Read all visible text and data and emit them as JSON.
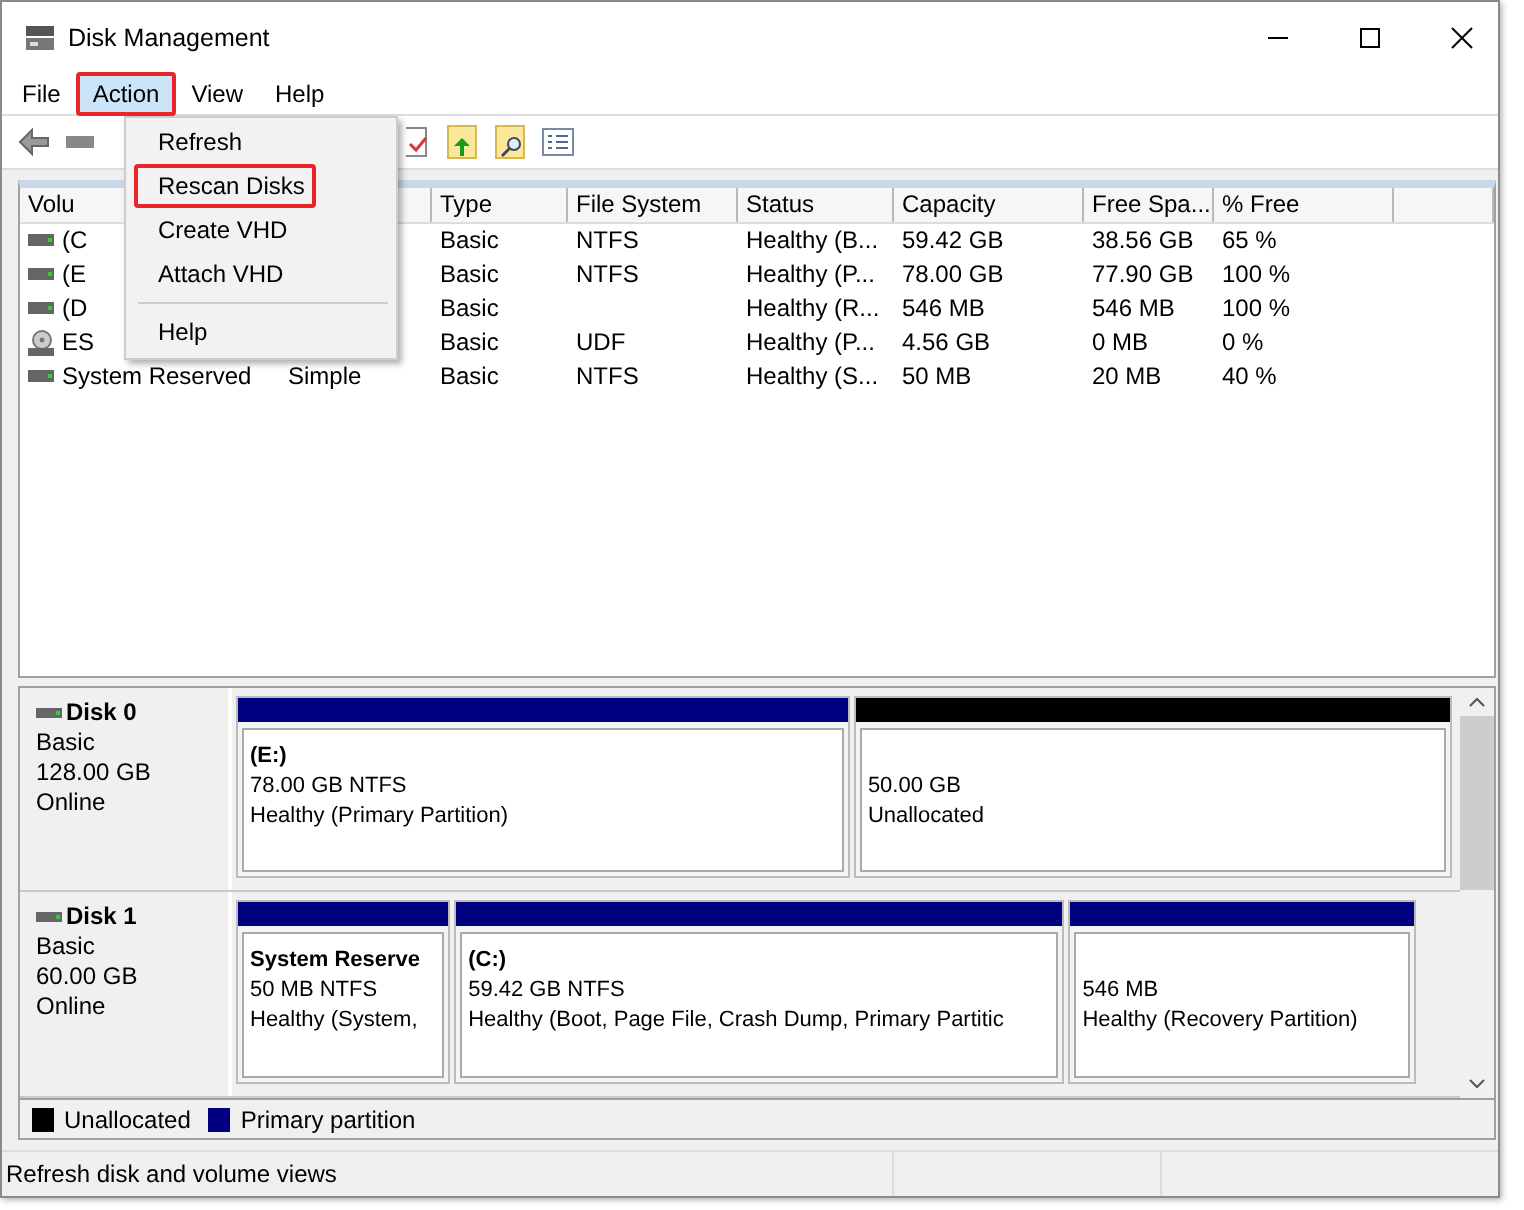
{
  "window": {
    "title": "Disk Management"
  },
  "menu_bar": [
    {
      "label": "File",
      "selected": false,
      "highlighted": false
    },
    {
      "label": "Action",
      "selected": true,
      "highlighted": true
    },
    {
      "label": "View",
      "selected": false,
      "highlighted": false
    },
    {
      "label": "Help",
      "selected": false,
      "highlighted": false
    }
  ],
  "action_menu": {
    "items": [
      {
        "kind": "item",
        "label": "Refresh",
        "highlighted": false
      },
      {
        "kind": "item",
        "label": "Rescan Disks",
        "highlighted": true
      },
      {
        "kind": "item",
        "label": "Create VHD",
        "highlighted": false
      },
      {
        "kind": "item",
        "label": "Attach VHD",
        "highlighted": false
      },
      {
        "kind": "separator"
      },
      {
        "kind": "item",
        "label": "Help",
        "highlighted": false
      }
    ]
  },
  "volume_table": {
    "columns": [
      "Volu",
      "",
      "Type",
      "File System",
      "Status",
      "Capacity",
      "Free Spa...",
      "% Free"
    ],
    "rows": [
      {
        "kind": "drive",
        "cells": [
          "(C",
          "",
          "Basic",
          "NTFS",
          "Healthy (B...",
          "59.42 GB",
          "38.56 GB",
          "65 %"
        ]
      },
      {
        "kind": "drive",
        "cells": [
          "(E",
          "",
          "Basic",
          "NTFS",
          "Healthy (P...",
          "78.00 GB",
          "77.90 GB",
          "100 %"
        ]
      },
      {
        "kind": "drive",
        "cells": [
          "(D",
          "",
          "Basic",
          "",
          "Healthy (R...",
          "546 MB",
          "546 MB",
          "100 %"
        ]
      },
      {
        "kind": "disc",
        "cells": [
          "ES",
          "",
          "Basic",
          "UDF",
          "Healthy (P...",
          "4.56 GB",
          "0 MB",
          "0 %"
        ]
      },
      {
        "kind": "drive",
        "cells": [
          "System Reserved",
          "Simple",
          "Basic",
          "NTFS",
          "Healthy (S...",
          "50 MB",
          "20 MB",
          "40 %"
        ]
      }
    ]
  },
  "disks": [
    {
      "name": "Disk 0",
      "type": "Basic",
      "size": "128.00 GB",
      "state": "Online",
      "partitions": [
        {
          "kind": "primary",
          "name": "(E:)",
          "size": "78.00 GB NTFS",
          "status": "Healthy (Primary Partition)"
        },
        {
          "kind": "unallocated",
          "size": "50.00 GB",
          "status": "Unallocated"
        }
      ]
    },
    {
      "name": "Disk 1",
      "type": "Basic",
      "size": "60.00 GB",
      "state": "Online",
      "partitions": [
        {
          "kind": "primary",
          "name": "System Reserve",
          "size": "50 MB NTFS",
          "status": "Healthy (System,"
        },
        {
          "kind": "primary",
          "name": "(C:)",
          "size": "59.42 GB NTFS",
          "status": "Healthy (Boot, Page File, Crash Dump, Primary Partitic"
        },
        {
          "kind": "primary",
          "size": "546 MB",
          "status": "Healthy (Recovery Partition)"
        }
      ]
    }
  ],
  "legend": [
    {
      "label": "Unallocated",
      "color": "#000000"
    },
    {
      "label": "Primary partition",
      "color": "#000080"
    }
  ],
  "status_bar": "Refresh disk and volume views"
}
